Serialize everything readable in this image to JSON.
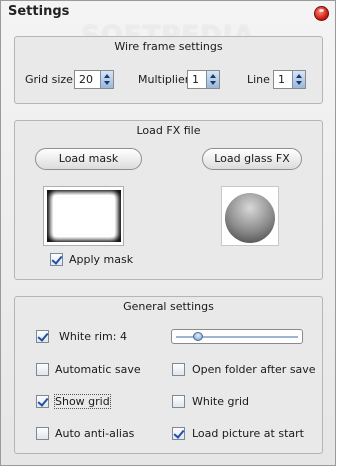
{
  "window": {
    "title": "Settings",
    "watermark": "SOFTPEDIA"
  },
  "wire_frame": {
    "title": "Wire frame settings",
    "grid_size": {
      "label": "Grid size",
      "value": "20"
    },
    "multiplier": {
      "label": "Multiplier",
      "value": "1"
    },
    "line": {
      "label": "Line",
      "value": "1"
    }
  },
  "fx_file": {
    "title": "Load FX file",
    "load_mask_label": "Load mask",
    "load_glass_label": "Load glass FX",
    "apply_mask": {
      "label": "Apply mask",
      "checked": true
    }
  },
  "general": {
    "title": "General settings",
    "white_rim": {
      "label": "White rim: 4",
      "checked": true,
      "slider_fraction": 0.15
    },
    "automatic_save": {
      "label": "Automatic save",
      "checked": false
    },
    "open_folder": {
      "label": "Open folder after save",
      "checked": false
    },
    "show_grid": {
      "label": "Show grid",
      "checked": true
    },
    "white_grid": {
      "label": "White grid",
      "checked": false
    },
    "auto_anti_alias": {
      "label": "Auto anti-alias",
      "checked": false
    },
    "load_picture": {
      "label": "Load picture at start",
      "checked": true
    }
  }
}
